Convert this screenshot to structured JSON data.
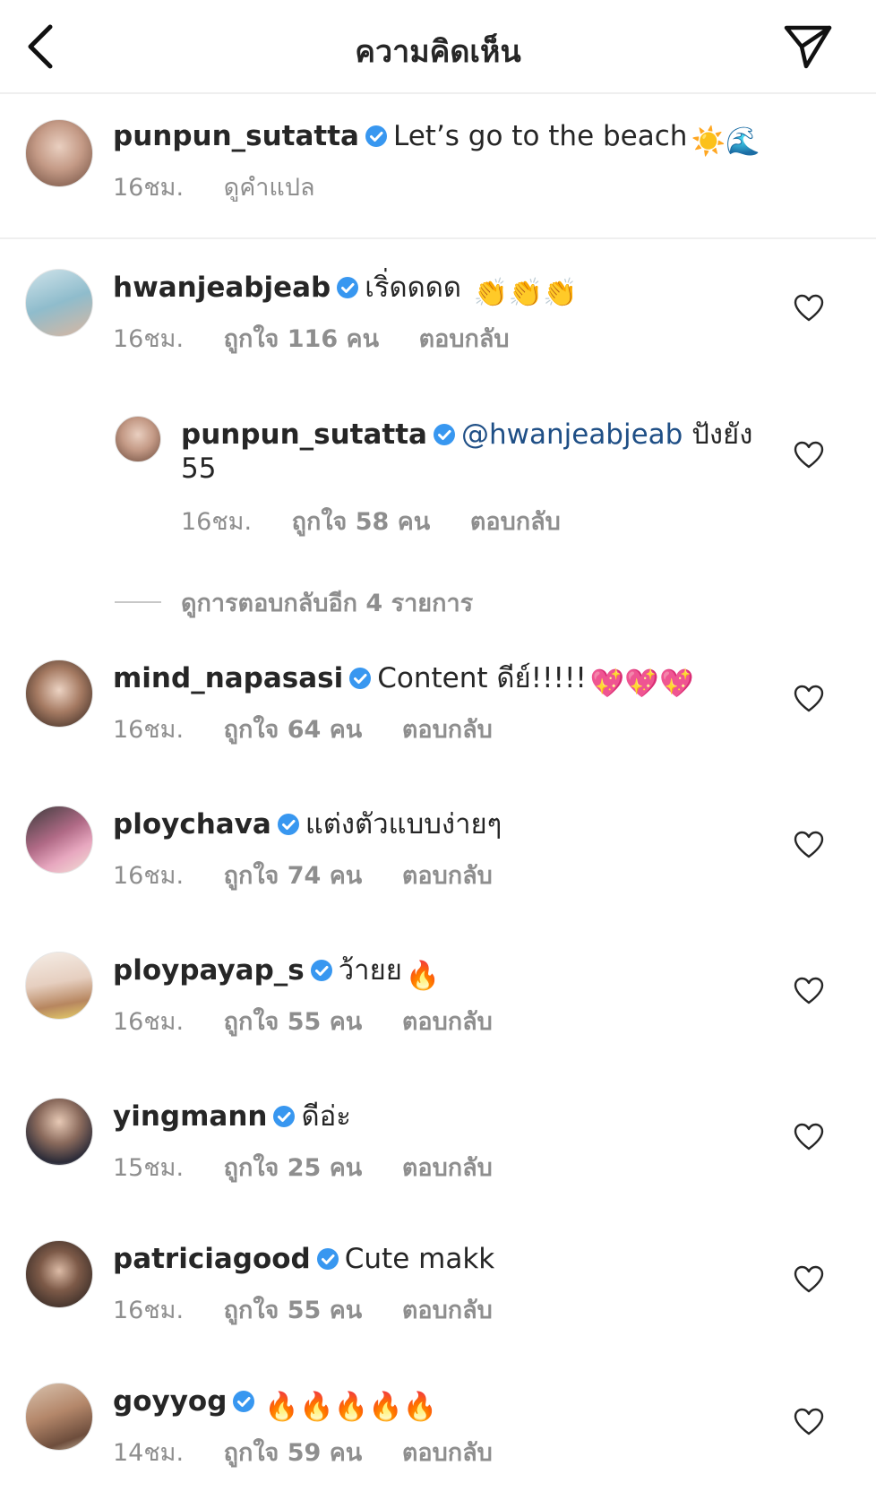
{
  "header": {
    "title": "ความคิดเห็น",
    "back_icon": "chevron-left-icon",
    "send_icon": "paper-plane-icon"
  },
  "caption": {
    "username": "punpun_sutatta",
    "text": "Let’s go to the beach",
    "emojis": "☀️🌊",
    "time": "16ชม.",
    "translate": "ดูคำแปล"
  },
  "comments": [
    {
      "username": "hwanjeabjeab",
      "text": "เริ่ดดดด",
      "emojis": "👏👏👏",
      "time": "16ชม.",
      "likes": "ถูกใจ 116 คน",
      "reply": "ตอบกลับ"
    },
    {
      "username": "punpun_sutatta",
      "mention": "@hwanjeabjeab",
      "text": "ปังยัง",
      "text2": "55",
      "time": "16ชม.",
      "likes": "ถูกใจ 58 คน",
      "reply": "ตอบกลับ"
    },
    {
      "username": "mind_napasasi",
      "text": "Content ดีย์!!!!!",
      "emojis": "💖💖💖",
      "time": "16ชม.",
      "likes": "ถูกใจ 64 คน",
      "reply": "ตอบกลับ"
    },
    {
      "username": "ploychava",
      "text": "แต่งตัวแบบง่ายๆ",
      "time": "16ชม.",
      "likes": "ถูกใจ 74 คน",
      "reply": "ตอบกลับ"
    },
    {
      "username": "ploypayap_s",
      "text": "ว้ายย",
      "emojis": "🔥",
      "time": "16ชม.",
      "likes": "ถูกใจ 55 คน",
      "reply": "ตอบกลับ"
    },
    {
      "username": "yingmann",
      "text": "ดีอ่ะ",
      "time": "15ชม.",
      "likes": "ถูกใจ 25 คน",
      "reply": "ตอบกลับ"
    },
    {
      "username": "patriciagood",
      "text": "Cute makk",
      "time": "16ชม.",
      "likes": "ถูกใจ 55 คน",
      "reply": "ตอบกลับ"
    },
    {
      "username": "goyyog",
      "text": "",
      "emojis": "🔥🔥🔥🔥🔥",
      "time": "14ชม.",
      "likes": "ถูกใจ 59 คน",
      "reply": "ตอบกลับ"
    }
  ],
  "view_more_replies": "ดูการตอบกลับอีก 4 รายการ",
  "colors": {
    "verified": "#3897f0",
    "mention": "#1f4f86",
    "meta": "#8e8e8e",
    "text": "#262626"
  }
}
